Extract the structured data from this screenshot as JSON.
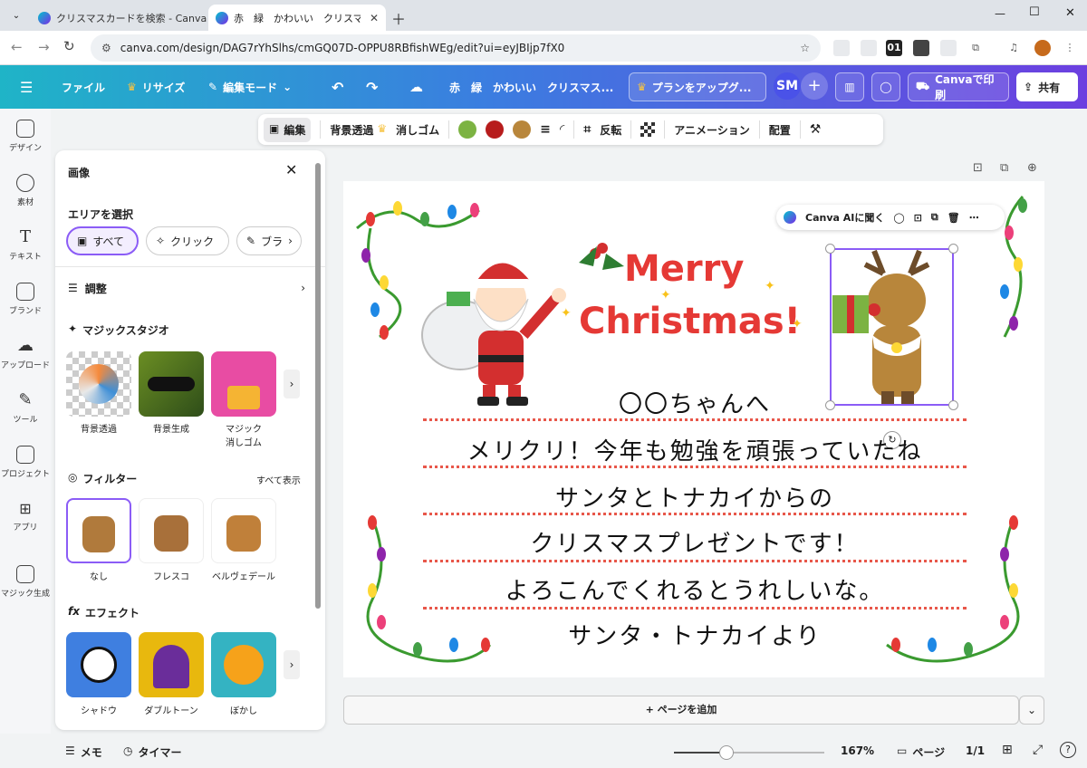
{
  "browser": {
    "tabs": [
      {
        "label": "クリスマスカードを検索 - Canva"
      },
      {
        "label": "赤　緑　かわいい　クリスマスカード"
      }
    ],
    "url": "canva.com/design/DAG7rYhSlhs/cmGQ07D-OPPU8RBfishWEg/edit?ui=eyJBIjp7fX0",
    "ext_label": "01"
  },
  "header": {
    "file": "ファイル",
    "resize": "リサイズ",
    "edit_mode": "編集モード",
    "doc_title": "赤　緑　かわいい　クリスマス...",
    "upgrade": "プランをアップグ...",
    "avatar": "SM",
    "print": "Canvaで印刷",
    "share": "共有"
  },
  "rail": [
    {
      "label": "デザイン"
    },
    {
      "label": "素材"
    },
    {
      "label": "テキスト"
    },
    {
      "label": "ブランド"
    },
    {
      "label": "アップロード"
    },
    {
      "label": "ツール"
    },
    {
      "label": "プロジェクト"
    },
    {
      "label": "アプリ"
    },
    {
      "label": "マジック生成"
    }
  ],
  "panel": {
    "title": "画像",
    "area_heading": "エリアを選択",
    "area_chips": [
      "すべて",
      "クリック",
      "ブラ"
    ],
    "adjust": "調整",
    "magic_studio": "マジックスタジオ",
    "magic_items": [
      "背景透過",
      "背景生成",
      "マジック\n消しゴム"
    ],
    "filter_heading": "フィルター",
    "filter_all": "すべて表示",
    "filter_items": [
      "なし",
      "フレスコ",
      "ベルヴェデール"
    ],
    "effect_heading": "エフェクト",
    "effect_items": [
      "シャドウ",
      "ダブルトーン",
      "ぼかし"
    ]
  },
  "toolbar": {
    "edit": "編集",
    "bg_remove": "背景透過",
    "eraser": "消しゴム",
    "colors": [
      "#7cb342",
      "#b71c1c",
      "#b8863b"
    ],
    "flip": "反転",
    "animation": "アニメーション",
    "position": "配置"
  },
  "float_menu": {
    "ask_ai": "Canva AIに聞く"
  },
  "card": {
    "title_line1": "Merry",
    "title_line2": "Christmas!",
    "lines": [
      "〇〇ちゃんへ",
      "メリクリ！今年も勉強を頑張っていたね",
      "サンタとトナカイからの",
      "クリスマスプレゼントです！",
      "よろこんでくれるとうれしいな。",
      "サンタ・トナカイより"
    ]
  },
  "add_page": "+ ページを追加",
  "footer": {
    "memo": "メモ",
    "timer": "タイマー",
    "zoom": "167%",
    "zoom_level": 0.35,
    "pages_label": "ページ",
    "page_count": "1/1"
  }
}
